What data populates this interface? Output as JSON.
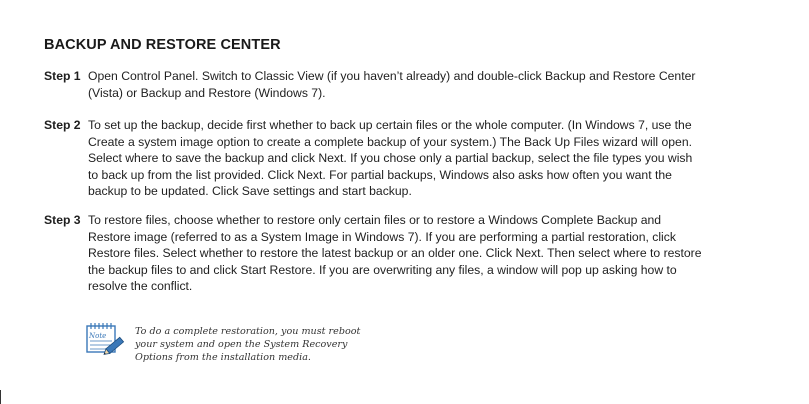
{
  "heading": "BACKUP AND RESTORE CENTER",
  "steps": [
    {
      "label": "Step 1",
      "text": "Open Control Panel. Switch to Classic View (if you haven’t already) and double-click Backup and Restore Center (Vista) or Backup and Restore (Windows 7)."
    },
    {
      "label": "Step 2",
      "text": "To set up the backup, decide first whether to back up certain files or the whole computer. (In Windows 7, use the Create a system image option to create a complete backup of your system.) The Back Up Files wizard will open. Select where to save the backup and click Next. If you chose only a partial backup, select the file types you wish to back up from the list provided. Click Next. For partial backups, Windows also asks how often you want the backup to be updated. Click Save settings and start backup."
    },
    {
      "label": "Step 3",
      "text": "To restore files, choose whether to restore only certain files or to restore a Windows Complete Backup and Restore image (referred to as a System Image in Windows 7). If you are performing a partial restoration, click Restore files. Select whether to restore the latest backup or an older one. Click Next. Then select where to restore the backup files to and click Start Restore. If you are overwriting any files, a window will pop up asking how to resolve the conflict."
    }
  ],
  "note": {
    "icon": "note-pad-pencil-icon",
    "icon_label": "Note",
    "text": "To do a complete restoration, you must reboot your system and open the System Recovery Options from the installation media.",
    "accent_color": "#3a78b8"
  }
}
